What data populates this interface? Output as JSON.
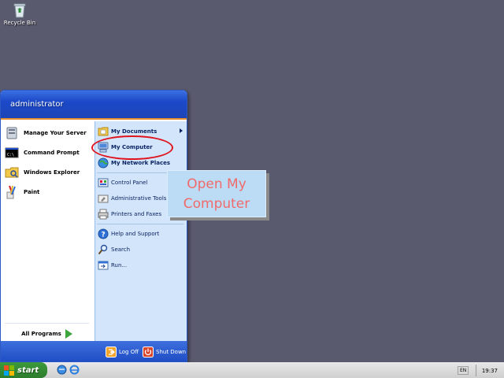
{
  "desktop": {
    "recycle_bin_label": "Recycle Bin"
  },
  "start_menu": {
    "user_name": "administrator",
    "pinned": [
      {
        "label": "Manage Your Server"
      },
      {
        "label": "Command Prompt"
      },
      {
        "label": "Windows Explorer"
      },
      {
        "label": "Paint"
      }
    ],
    "all_programs_label": "All Programs",
    "places": [
      {
        "label": "My Documents"
      },
      {
        "label": "My Computer"
      },
      {
        "label": "My Network Places"
      }
    ],
    "system": [
      {
        "label": "Control Panel"
      },
      {
        "label": "Administrative Tools"
      },
      {
        "label": "Printers and Faxes"
      }
    ],
    "tools": [
      {
        "label": "Help and Support"
      },
      {
        "label": "Search"
      },
      {
        "label": "Run..."
      }
    ],
    "log_off_label": "Log Off",
    "shut_down_label": "Shut Down"
  },
  "hint": {
    "line1": "Open My",
    "line2": "Computer"
  },
  "taskbar": {
    "start_label": "start",
    "language": "EN",
    "clock": "19:37"
  },
  "colors": {
    "desktop": "#5a5a6e",
    "menu_header": "#1c49c9",
    "menu_right_pane": "#d3e5fa",
    "annotation_ring": "#e0141e",
    "hint_text": "#f06a6a",
    "hint_bg": "#bcdcf6"
  }
}
